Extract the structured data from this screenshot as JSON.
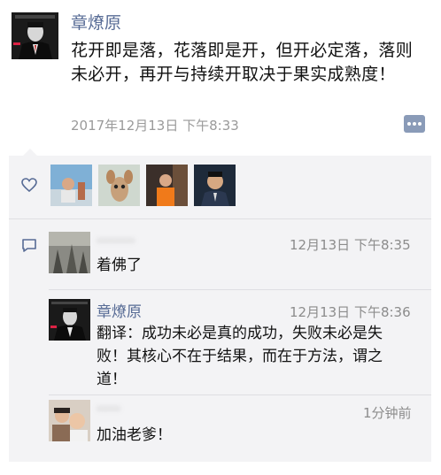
{
  "post": {
    "author": "章燎原",
    "text": "花开即是落，花落即是开，但开必定落，落则未必开，再开与持续开取决于果实成熟度！",
    "time": "2017年12月13日 下午8:33"
  },
  "likes": {
    "icon": "heart-outline-icon",
    "avatars": [
      "liker-avatar-1",
      "liker-avatar-2",
      "liker-avatar-3",
      "liker-avatar-4"
    ]
  },
  "comments": [
    {
      "author": "········",
      "time": "12月13日 下午8:35",
      "text": "着佛了"
    },
    {
      "author": "章燎原",
      "time": "12月13日 下午8:36",
      "text": "翻译：成功未必是真的成功，失败未必是失败！其核心不在于结果，而在于方法，谓之道！"
    },
    {
      "author": "·····",
      "time": "1分钟前",
      "text": "加油老爹！"
    }
  ],
  "colors": {
    "name_link": "#576b95",
    "panel_bg": "#f3f3f5",
    "time_gray": "#9a9a9a"
  }
}
